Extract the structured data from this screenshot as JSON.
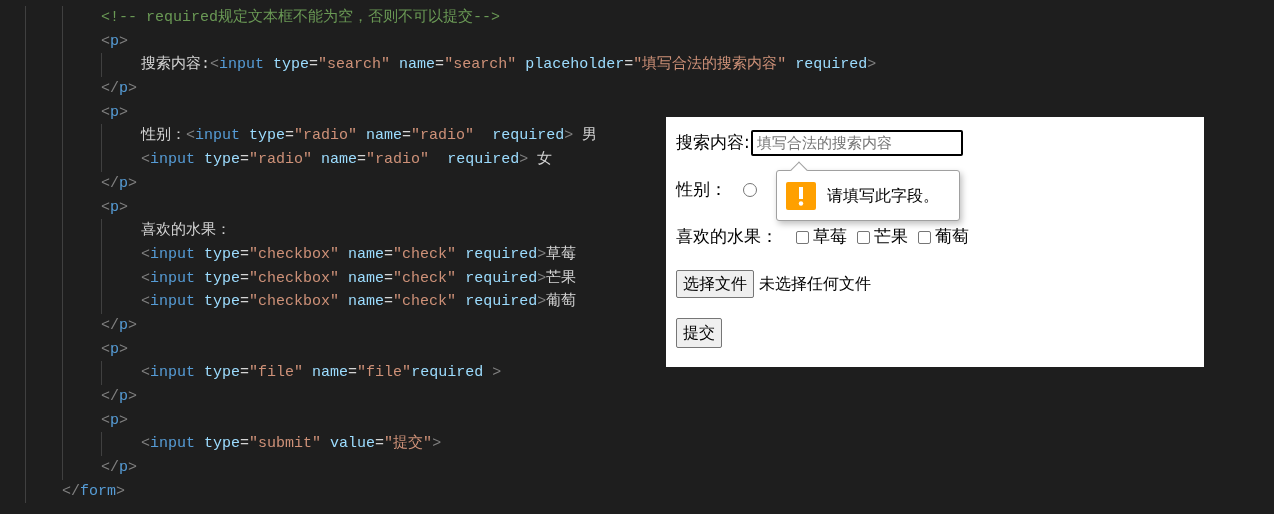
{
  "editor": {
    "lines": [
      {
        "children": [
          {
            "tokens": [
              {
                "kind": "comment",
                "text": "<!-- required规定文本框不能为空，否则不可以提交-->"
              }
            ]
          },
          {
            "tokens": [
              {
                "kind": "punct",
                "text": "<"
              },
              {
                "kind": "tag",
                "text": "p"
              },
              {
                "kind": "punct",
                "text": ">"
              }
            ],
            "children": [
              {
                "tokens": [
                  {
                    "kind": "text",
                    "text": "搜索内容:"
                  },
                  {
                    "kind": "punct",
                    "text": "<"
                  },
                  {
                    "kind": "tag",
                    "text": "input"
                  },
                  {
                    "kind": "attr",
                    "text": " type"
                  },
                  {
                    "kind": "text",
                    "text": "="
                  },
                  {
                    "kind": "string",
                    "text": "\"search\""
                  },
                  {
                    "kind": "attr",
                    "text": " name"
                  },
                  {
                    "kind": "text",
                    "text": "="
                  },
                  {
                    "kind": "string",
                    "text": "\"search\""
                  },
                  {
                    "kind": "attr",
                    "text": " placeholder"
                  },
                  {
                    "kind": "text",
                    "text": "="
                  },
                  {
                    "kind": "string",
                    "text": "\"填写合法的搜索内容\""
                  },
                  {
                    "kind": "attr",
                    "text": " required"
                  },
                  {
                    "kind": "punct",
                    "text": ">"
                  }
                ]
              }
            ]
          },
          {
            "tokens": [
              {
                "kind": "punct",
                "text": "</"
              },
              {
                "kind": "tag",
                "text": "p"
              },
              {
                "kind": "punct",
                "text": ">"
              }
            ]
          },
          {
            "tokens": [
              {
                "kind": "punct",
                "text": "<"
              },
              {
                "kind": "tag",
                "text": "p"
              },
              {
                "kind": "punct",
                "text": ">"
              }
            ],
            "children": [
              {
                "tokens": [
                  {
                    "kind": "text",
                    "text": "性别："
                  },
                  {
                    "kind": "punct",
                    "text": "<"
                  },
                  {
                    "kind": "tag",
                    "text": "input"
                  },
                  {
                    "kind": "attr",
                    "text": " type"
                  },
                  {
                    "kind": "text",
                    "text": "="
                  },
                  {
                    "kind": "string",
                    "text": "\"radio\""
                  },
                  {
                    "kind": "attr",
                    "text": " name"
                  },
                  {
                    "kind": "text",
                    "text": "="
                  },
                  {
                    "kind": "string",
                    "text": "\"radio\""
                  },
                  {
                    "kind": "attr",
                    "text": "  required"
                  },
                  {
                    "kind": "punct",
                    "text": ">"
                  },
                  {
                    "kind": "text",
                    "text": " 男"
                  }
                ]
              },
              {
                "tokens": [
                  {
                    "kind": "punct",
                    "text": "<"
                  },
                  {
                    "kind": "tag",
                    "text": "input"
                  },
                  {
                    "kind": "attr",
                    "text": " type"
                  },
                  {
                    "kind": "text",
                    "text": "="
                  },
                  {
                    "kind": "string",
                    "text": "\"radio\""
                  },
                  {
                    "kind": "attr",
                    "text": " name"
                  },
                  {
                    "kind": "text",
                    "text": "="
                  },
                  {
                    "kind": "string",
                    "text": "\"radio\""
                  },
                  {
                    "kind": "attr",
                    "text": "  required"
                  },
                  {
                    "kind": "punct",
                    "text": ">"
                  },
                  {
                    "kind": "text",
                    "text": " 女"
                  }
                ]
              }
            ]
          },
          {
            "tokens": [
              {
                "kind": "punct",
                "text": "</"
              },
              {
                "kind": "tag",
                "text": "p"
              },
              {
                "kind": "punct",
                "text": ">"
              }
            ]
          },
          {
            "tokens": [
              {
                "kind": "punct",
                "text": "<"
              },
              {
                "kind": "tag",
                "text": "p"
              },
              {
                "kind": "punct",
                "text": ">"
              }
            ],
            "children": [
              {
                "tokens": [
                  {
                    "kind": "text",
                    "text": "喜欢的水果："
                  }
                ]
              },
              {
                "tokens": [
                  {
                    "kind": "punct",
                    "text": "<"
                  },
                  {
                    "kind": "tag",
                    "text": "input"
                  },
                  {
                    "kind": "attr",
                    "text": " type"
                  },
                  {
                    "kind": "text",
                    "text": "="
                  },
                  {
                    "kind": "string",
                    "text": "\"checkbox\""
                  },
                  {
                    "kind": "attr",
                    "text": " name"
                  },
                  {
                    "kind": "text",
                    "text": "="
                  },
                  {
                    "kind": "string",
                    "text": "\"check\""
                  },
                  {
                    "kind": "attr",
                    "text": " required"
                  },
                  {
                    "kind": "punct",
                    "text": ">"
                  },
                  {
                    "kind": "text",
                    "text": "草莓"
                  }
                ]
              },
              {
                "tokens": [
                  {
                    "kind": "punct",
                    "text": "<"
                  },
                  {
                    "kind": "tag",
                    "text": "input"
                  },
                  {
                    "kind": "attr",
                    "text": " type"
                  },
                  {
                    "kind": "text",
                    "text": "="
                  },
                  {
                    "kind": "string",
                    "text": "\"checkbox\""
                  },
                  {
                    "kind": "attr",
                    "text": " name"
                  },
                  {
                    "kind": "text",
                    "text": "="
                  },
                  {
                    "kind": "string",
                    "text": "\"check\""
                  },
                  {
                    "kind": "attr",
                    "text": " required"
                  },
                  {
                    "kind": "punct",
                    "text": ">"
                  },
                  {
                    "kind": "text",
                    "text": "芒果"
                  }
                ]
              },
              {
                "tokens": [
                  {
                    "kind": "punct",
                    "text": "<"
                  },
                  {
                    "kind": "tag",
                    "text": "input"
                  },
                  {
                    "kind": "attr",
                    "text": " type"
                  },
                  {
                    "kind": "text",
                    "text": "="
                  },
                  {
                    "kind": "string",
                    "text": "\"checkbox\""
                  },
                  {
                    "kind": "attr",
                    "text": " name"
                  },
                  {
                    "kind": "text",
                    "text": "="
                  },
                  {
                    "kind": "string",
                    "text": "\"check\""
                  },
                  {
                    "kind": "attr",
                    "text": " required"
                  },
                  {
                    "kind": "punct",
                    "text": ">"
                  },
                  {
                    "kind": "text",
                    "text": "葡萄"
                  }
                ]
              }
            ]
          },
          {
            "tokens": [
              {
                "kind": "punct",
                "text": "</"
              },
              {
                "kind": "tag",
                "text": "p"
              },
              {
                "kind": "punct",
                "text": ">"
              }
            ]
          },
          {
            "tokens": [
              {
                "kind": "punct",
                "text": "<"
              },
              {
                "kind": "tag",
                "text": "p"
              },
              {
                "kind": "punct",
                "text": ">"
              }
            ],
            "children": [
              {
                "tokens": [
                  {
                    "kind": "punct",
                    "text": "<"
                  },
                  {
                    "kind": "tag",
                    "text": "input"
                  },
                  {
                    "kind": "attr",
                    "text": " type"
                  },
                  {
                    "kind": "text",
                    "text": "="
                  },
                  {
                    "kind": "string",
                    "text": "\"file\""
                  },
                  {
                    "kind": "attr",
                    "text": " name"
                  },
                  {
                    "kind": "text",
                    "text": "="
                  },
                  {
                    "kind": "string",
                    "text": "\"file\""
                  },
                  {
                    "kind": "attr",
                    "text": "required"
                  },
                  {
                    "kind": "punct",
                    "text": " >"
                  }
                ]
              }
            ]
          },
          {
            "tokens": [
              {
                "kind": "punct",
                "text": "</"
              },
              {
                "kind": "tag",
                "text": "p"
              },
              {
                "kind": "punct",
                "text": ">"
              }
            ]
          },
          {
            "tokens": [
              {
                "kind": "punct",
                "text": "<"
              },
              {
                "kind": "tag",
                "text": "p"
              },
              {
                "kind": "punct",
                "text": ">"
              }
            ],
            "children": [
              {
                "tokens": [
                  {
                    "kind": "punct",
                    "text": "<"
                  },
                  {
                    "kind": "tag",
                    "text": "input"
                  },
                  {
                    "kind": "attr",
                    "text": " type"
                  },
                  {
                    "kind": "text",
                    "text": "="
                  },
                  {
                    "kind": "string",
                    "text": "\"submit\""
                  },
                  {
                    "kind": "attr",
                    "text": " value"
                  },
                  {
                    "kind": "text",
                    "text": "="
                  },
                  {
                    "kind": "string",
                    "text": "\"提交\""
                  },
                  {
                    "kind": "punct",
                    "text": ">"
                  }
                ]
              }
            ]
          },
          {
            "tokens": [
              {
                "kind": "punct",
                "text": "</"
              },
              {
                "kind": "tag",
                "text": "p"
              },
              {
                "kind": "punct",
                "text": ">"
              }
            ]
          }
        ]
      },
      {
        "tokens": [
          {
            "kind": "punct",
            "text": "</"
          },
          {
            "kind": "tag",
            "text": "form"
          },
          {
            "kind": "punct",
            "text": ">"
          }
        ]
      }
    ]
  },
  "preview": {
    "search": {
      "label": "搜索内容:",
      "placeholder": "填写合法的搜索内容",
      "focused": true
    },
    "gender": {
      "label": "性别：",
      "options": [
        {
          "selected": false
        }
      ]
    },
    "fruits": {
      "label": "喜欢的水果：",
      "options": [
        {
          "label": "草莓",
          "checked": false
        },
        {
          "label": "芒果",
          "checked": false
        },
        {
          "label": "葡萄",
          "checked": false
        }
      ]
    },
    "file": {
      "button": "选择文件",
      "status": "未选择任何文件"
    },
    "submit": {
      "label": "提交"
    },
    "tooltip": {
      "message": "请填写此字段。"
    }
  }
}
